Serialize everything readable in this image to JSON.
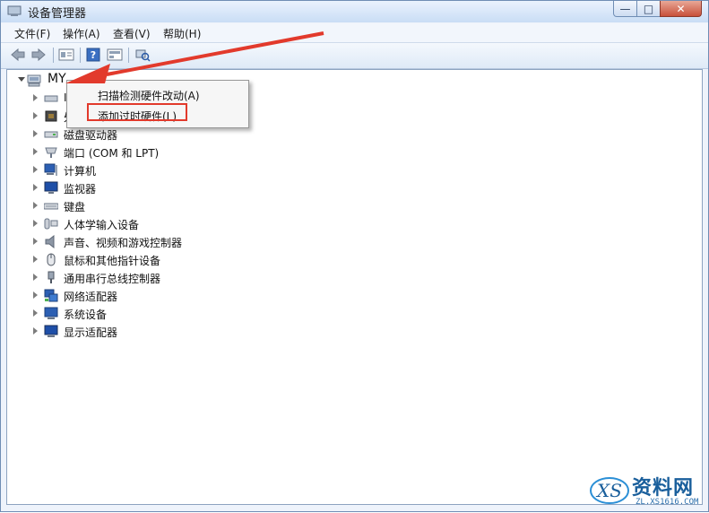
{
  "window": {
    "title": "设备管理器"
  },
  "menu": [
    "文件(F)",
    "操作(A)",
    "查看(V)",
    "帮助(H)"
  ],
  "tree": {
    "root": "MY",
    "items": [
      {
        "label": "I",
        "icon": "drive-icon"
      },
      {
        "label": "处",
        "icon": "processor-icon"
      },
      {
        "label": "磁盘驱动器",
        "icon": "disk-drive-icon"
      },
      {
        "label": "端口 (COM 和 LPT)",
        "icon": "port-icon"
      },
      {
        "label": "计算机",
        "icon": "computer-icon"
      },
      {
        "label": "监视器",
        "icon": "monitor-icon"
      },
      {
        "label": "键盘",
        "icon": "keyboard-icon"
      },
      {
        "label": "人体学输入设备",
        "icon": "hid-icon"
      },
      {
        "label": "声音、视频和游戏控制器",
        "icon": "sound-icon"
      },
      {
        "label": "鼠标和其他指针设备",
        "icon": "mouse-icon"
      },
      {
        "label": "通用串行总线控制器",
        "icon": "usb-icon"
      },
      {
        "label": "网络适配器",
        "icon": "network-icon"
      },
      {
        "label": "系统设备",
        "icon": "system-device-icon"
      },
      {
        "label": "显示适配器",
        "icon": "display-adapter-icon"
      }
    ]
  },
  "context_menu": {
    "items": [
      "扫描检测硬件改动(A)",
      "添加过时硬件(L)"
    ],
    "highlighted_index": 1
  },
  "watermark": {
    "brand": "资料网",
    "url": "ZL.XS1616.COM"
  },
  "colors": {
    "highlight_box": "#e23a2c",
    "arrow": "#e23a2c"
  }
}
